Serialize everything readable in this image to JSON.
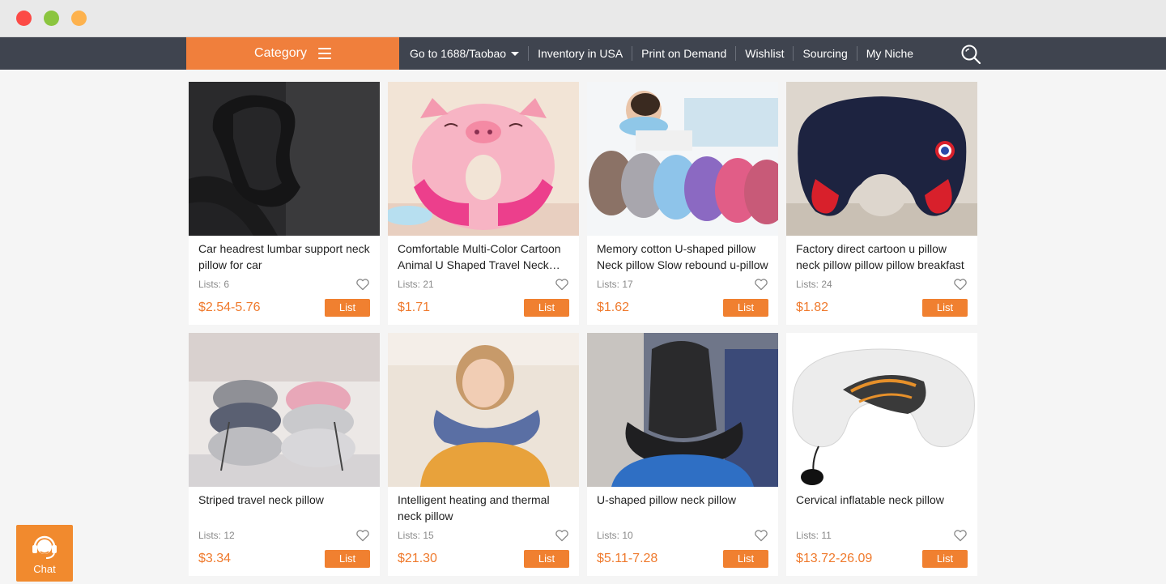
{
  "nav": {
    "category_label": "Category",
    "links": [
      "Go to 1688/Taobao",
      "Inventory in USA",
      "Print on Demand",
      "Wishlist",
      "Sourcing",
      "My Niche"
    ]
  },
  "products": [
    {
      "title": "Car headrest lumbar support neck pillow for car",
      "lists": "Lists: 6",
      "price": "$2.54-5.76",
      "button": "List"
    },
    {
      "title": "Comfortable Multi-Color Cartoon Animal U Shaped Travel Neck Pillow",
      "lists": "Lists: 21",
      "price": "$1.71",
      "button": "List"
    },
    {
      "title": "Memory cotton U-shaped pillow Neck pillow Slow rebound u-pillow",
      "lists": "Lists: 17",
      "price": "$1.62",
      "button": "List"
    },
    {
      "title": "Factory direct cartoon u pillow neck pillow pillow pillow breakfast",
      "lists": "Lists: 24",
      "price": "$1.82",
      "button": "List"
    },
    {
      "title": "Striped travel neck pillow",
      "lists": "Lists: 12",
      "price": "$3.34",
      "button": "List"
    },
    {
      "title": "Intelligent heating and thermal neck pillow",
      "lists": "Lists: 15",
      "price": "$21.30",
      "button": "List"
    },
    {
      "title": "U-shaped pillow neck pillow",
      "lists": "Lists: 10",
      "price": "$5.11-7.28",
      "button": "List"
    },
    {
      "title": "Cervical inflatable neck pillow",
      "lists": "Lists: 11",
      "price": "$13.72-26.09",
      "button": "List"
    }
  ],
  "chat": {
    "label": "Chat"
  },
  "icons": {
    "category": "hamburger-icon",
    "dropdown": "caret-down-icon",
    "search": "search-icon",
    "wishlist": "heart-icon",
    "chat": "headset-icon"
  },
  "colors": {
    "accent": "#f07f3c",
    "navbar": "#3f444f",
    "price": "#ef7a2d",
    "button": "#f08030",
    "background": "#f5f5f5"
  }
}
